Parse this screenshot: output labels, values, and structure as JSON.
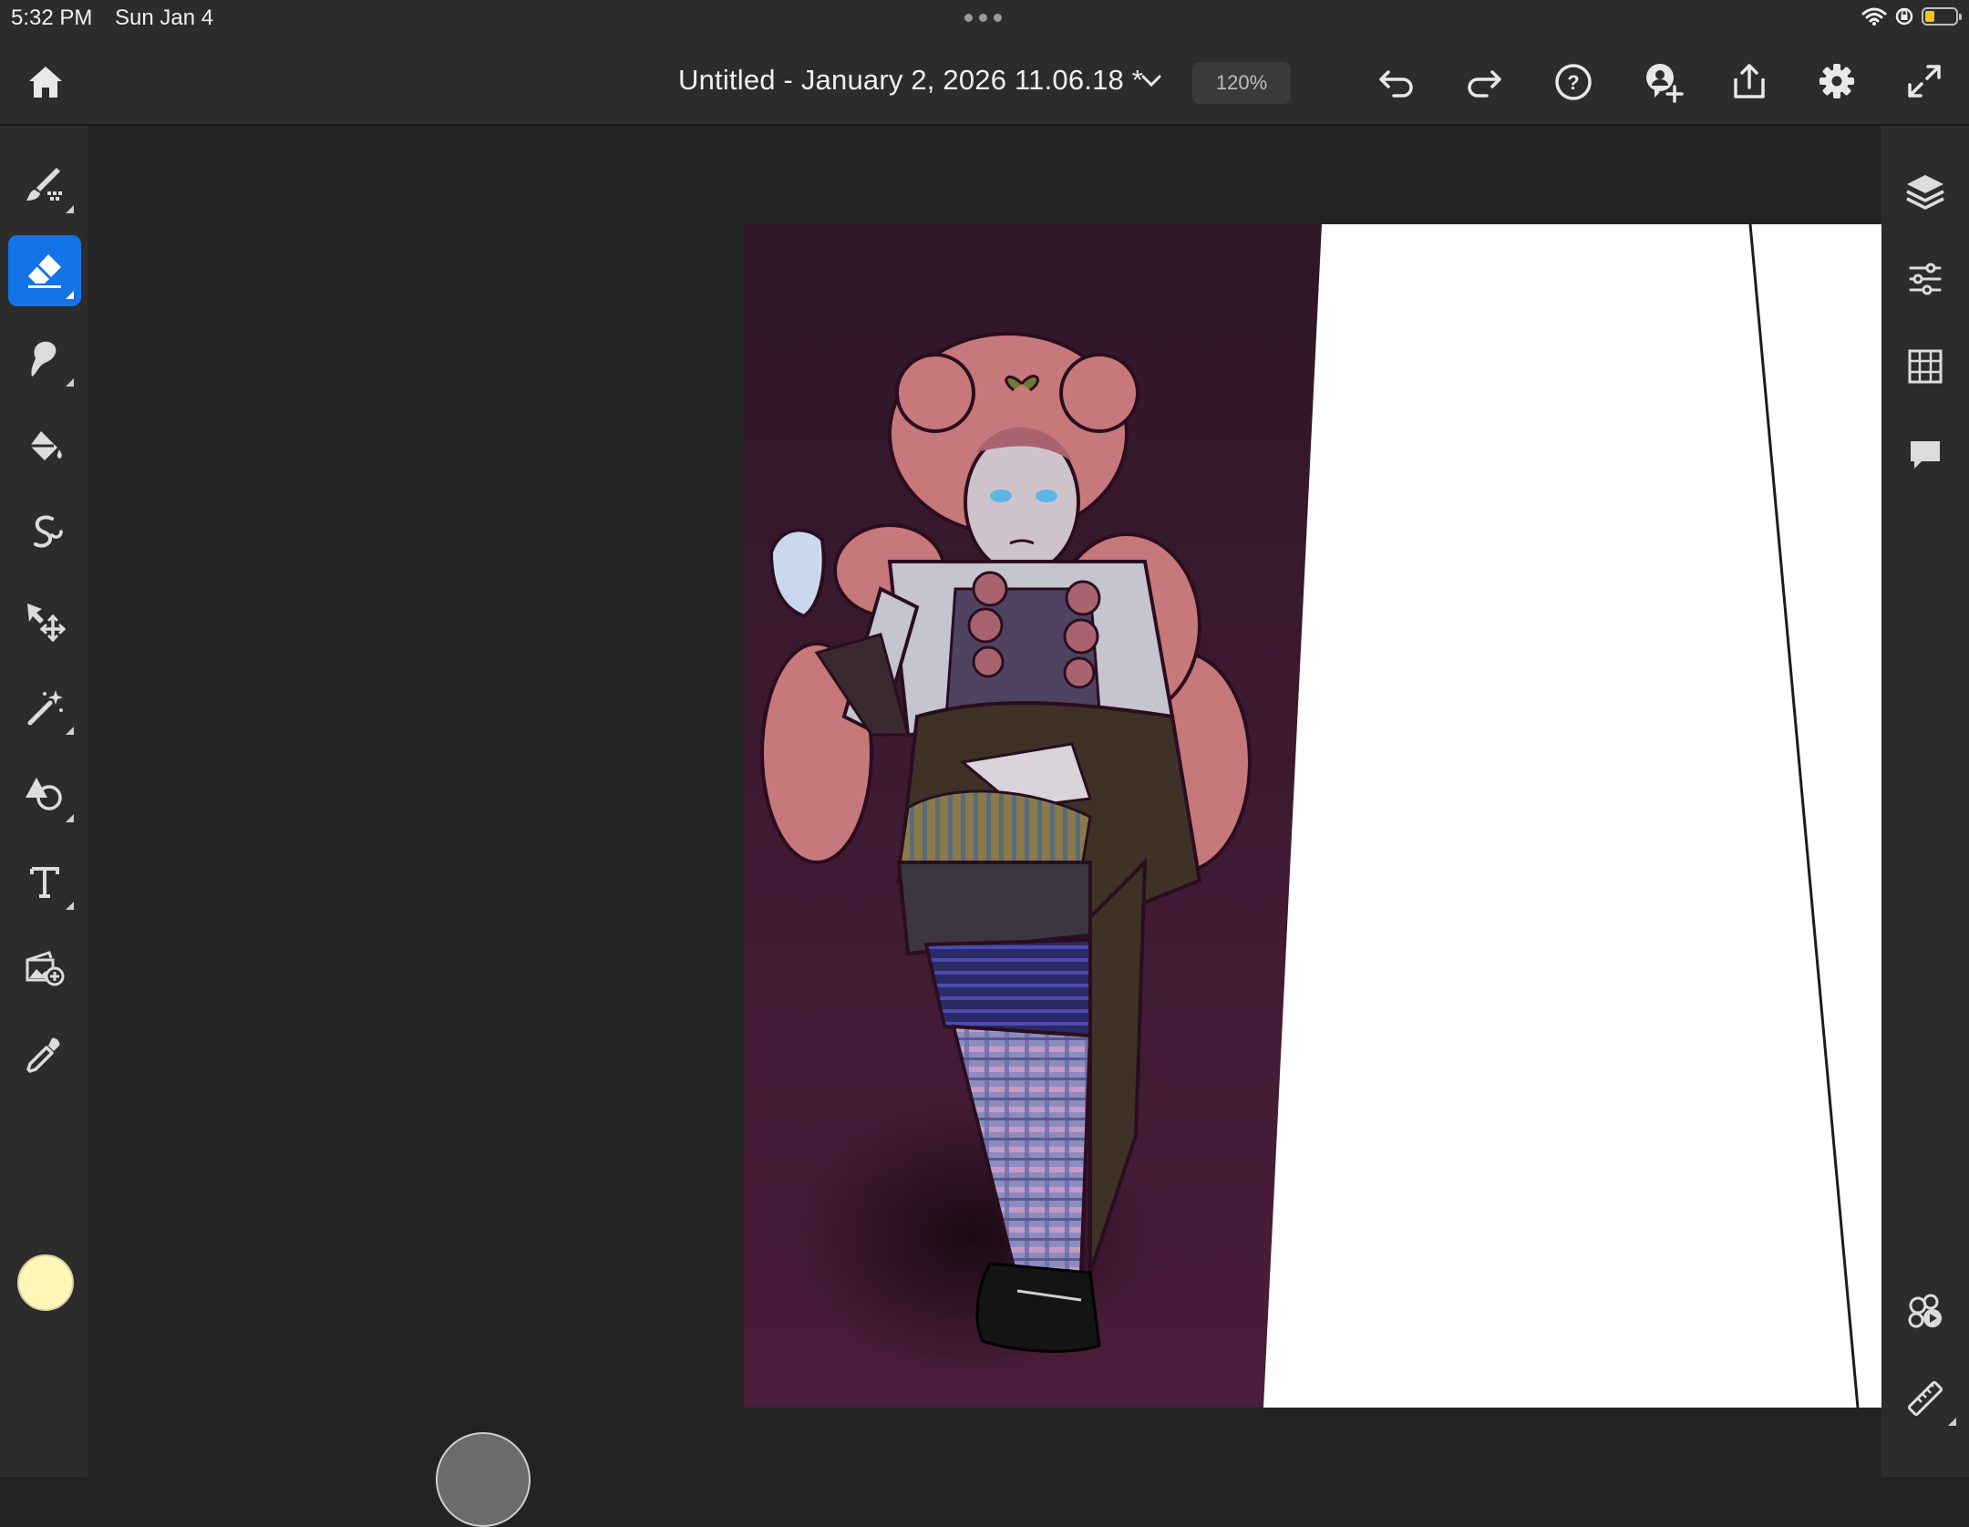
{
  "status_bar": {
    "time": "5:32 PM",
    "date": "Sun Jan 4",
    "icons": [
      "wifi-icon",
      "orientation-lock-icon",
      "battery-icon"
    ],
    "battery_color": "#f5c518"
  },
  "toolbar": {
    "document_title": "Untitled - January 2, 2026 11.06.18 *",
    "zoom_level": "120%",
    "buttons": [
      "home",
      "title-dropdown",
      "undo",
      "redo",
      "help",
      "invite",
      "share",
      "settings",
      "fullscreen"
    ]
  },
  "left_tools": {
    "items": [
      "brush",
      "eraser",
      "smudge",
      "fill",
      "liquify",
      "move",
      "magic-wand",
      "shape",
      "text",
      "add-image",
      "eyedropper"
    ],
    "active": "eraser",
    "accent_color": "#1473e6",
    "current_color": "#fff6b8"
  },
  "tool_options": {
    "size": "14",
    "opacity_preview": "transparent"
  },
  "right_tools": {
    "items": [
      "layers",
      "adjustments",
      "grid",
      "comments",
      "features",
      "ruler"
    ]
  },
  "canvas": {
    "background_color": "#4d1f3a",
    "paper_color": "#ffffff"
  }
}
